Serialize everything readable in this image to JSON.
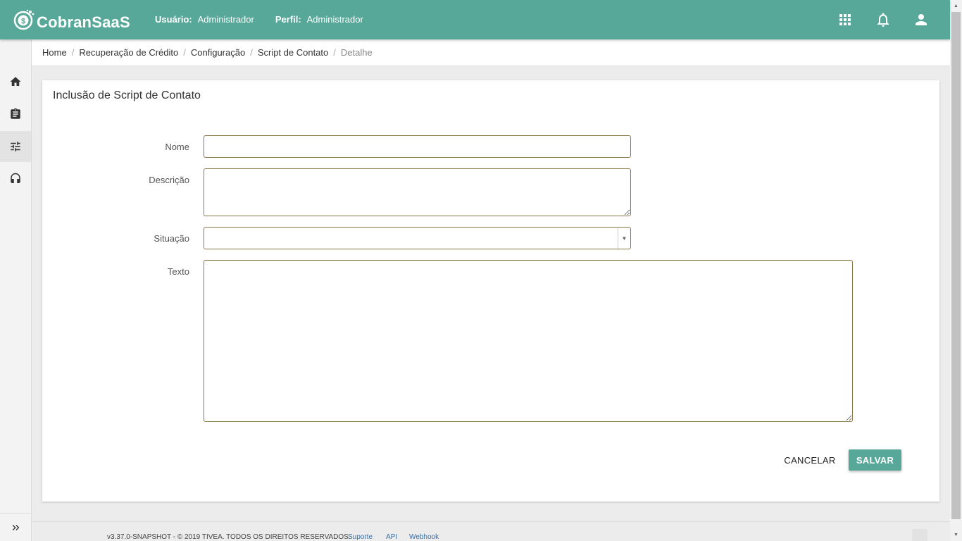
{
  "header": {
    "brand": "CobranSaaS",
    "user_label": "Usuário:",
    "user_value": "Administrador",
    "profile_label": "Perfil:",
    "profile_value": "Administrador",
    "icons": [
      "apps-grid-icon",
      "bell-icon",
      "user-icon"
    ],
    "color": "#57a899"
  },
  "sidebar": {
    "items": [
      {
        "icon": "home-icon",
        "active": false
      },
      {
        "icon": "clipboard-icon",
        "active": false
      },
      {
        "icon": "sliders-icon",
        "active": true
      },
      {
        "icon": "headset-icon",
        "active": false
      }
    ],
    "expand_icon": "double-chevron-right-icon"
  },
  "breadcrumb": [
    "Home",
    "Recuperação de Crédito",
    "Configuração",
    "Script de Contato",
    "Detalhe"
  ],
  "form": {
    "title": "Inclusão de Script de Contato",
    "fields": {
      "nome": {
        "label": "Nome",
        "value": ""
      },
      "descricao": {
        "label": "Descrição",
        "value": ""
      },
      "situacao": {
        "label": "Situação",
        "value": ""
      },
      "texto": {
        "label": "Texto",
        "value": ""
      }
    },
    "cancel_label": "CANCELAR",
    "save_label": "SALVAR"
  },
  "footer": {
    "copyright": "v3.37.0-SNAPSHOT - © 2019 TIVEA. TODOS OS DIREITOS RESERVADOS.",
    "links": [
      "Suporte",
      "API",
      "Webhook"
    ]
  }
}
